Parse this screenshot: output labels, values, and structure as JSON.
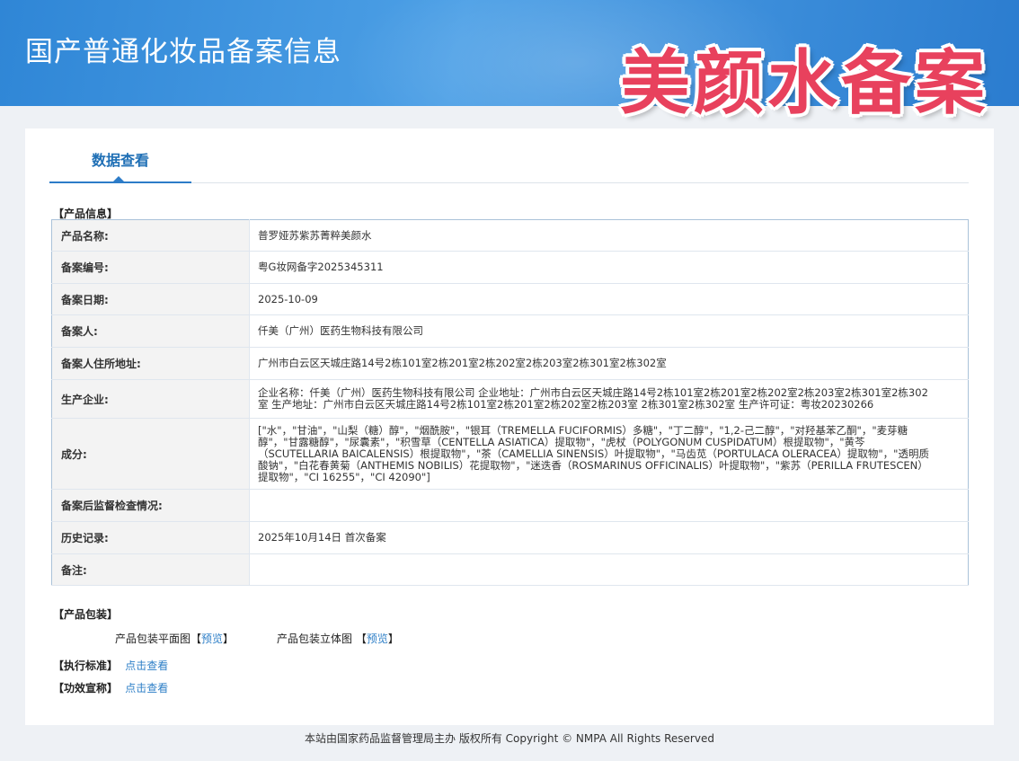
{
  "header": {
    "title": "国产普通化妆品备案信息",
    "watermark": "美颜水备案"
  },
  "tab": {
    "label": "数据查看"
  },
  "product_info": {
    "section_title": "【产品信息】",
    "rows": [
      {
        "key": "产品名称:",
        "value": "普罗娅苏紫苏菁粹美颜水"
      },
      {
        "key": "备案编号:",
        "value": "粤G妆网备字2025345311"
      },
      {
        "key": "备案日期:",
        "value": "2025-10-09"
      },
      {
        "key": "备案人:",
        "value": "仟美（广州）医药生物科技有限公司"
      },
      {
        "key": "备案人住所地址:",
        "value": "广州市白云区天城庄路14号2栋101室2栋201室2栋202室2栋203室2栋301室2栋302室"
      },
      {
        "key": "生产企业:",
        "value": "企业名称：仟美（广州）医药生物科技有限公司 企业地址：广州市白云区天城庄路14号2栋101室2栋201室2栋202室2栋203室2栋301室2栋302室 生产地址：广州市白云区天城庄路14号2栋101室2栋201室2栋202室2栋203室 2栋301室2栋302室 生产许可证：粤妆20230266"
      },
      {
        "key": "成分:",
        "value": "[\"水\"，\"甘油\"，\"山梨（糖）醇\"，\"烟酰胺\"，\"银耳（TREMELLA FUCIFORMIS）多糖\"，\"丁二醇\"，\"1,2-己二醇\"，\"对羟基苯乙酮\"，\"麦芽糖醇\"，\"甘露糖醇\"，\"尿囊素\"，\"积雪草（CENTELLA ASIATICA）提取物\"，\"虎杖（POLYGONUM CUSPIDATUM）根提取物\"，\"黄芩（SCUTELLARIA BAICALENSIS）根提取物\"，\"茶（CAMELLIA SINENSIS）叶提取物\"，\"马齿苋（PORTULACA OLERACEA）提取物\"，\"透明质酸钠\"，\"白花春黄菊（ANTHEMIS NOBILIS）花提取物\"，\"迷迭香（ROSMARINUS OFFICINALIS）叶提取物\"，\"紫苏（PERILLA FRUTESCEN）提取物\"，\"CI 16255\"，\"CI 42090\"]"
      },
      {
        "key": "备案后监督检查情况:",
        "value": ""
      },
      {
        "key": "历史记录:",
        "value": "2025年10月14日 首次备案"
      },
      {
        "key": "备注:",
        "value": ""
      }
    ]
  },
  "packaging": {
    "section_title": "【产品包装】",
    "flat_label": "产品包装平面图",
    "flat_link": "预览",
    "solid_label": "产品包装立体图",
    "solid_link": "预览",
    "bracket_open": "【",
    "bracket_close": "】"
  },
  "standard": {
    "label": "【执行标准】",
    "link": "点击查看"
  },
  "efficacy": {
    "label": "【功效宣称】",
    "link": "点击查看"
  },
  "footer": {
    "text": "本站由国家药品监督管理局主办 版权所有 Copyright © NMPA All Rights Reserved"
  }
}
